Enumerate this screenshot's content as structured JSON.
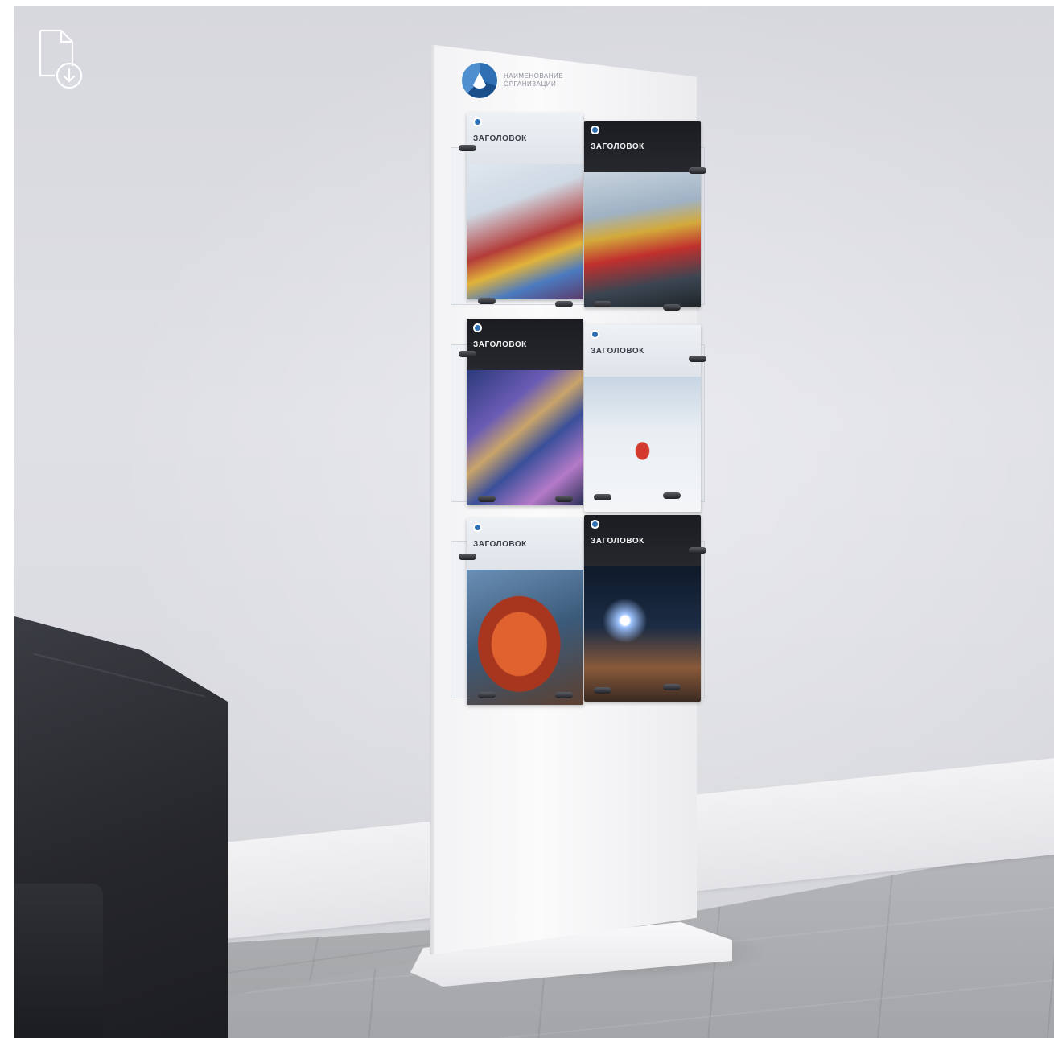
{
  "stand": {
    "logo_text": "НАИМЕНОВАНИЕ ОРГАНИЗАЦИИ"
  },
  "brochures": [
    {
      "title": "ЗАГОЛОВОК",
      "style": "light"
    },
    {
      "title": "ЗАГОЛОВОК",
      "style": "dark"
    },
    {
      "title": "ЗАГОЛОВОК",
      "style": "dark"
    },
    {
      "title": "ЗАГОЛОВОК",
      "style": "light"
    },
    {
      "title": "ЗАГОЛОВОК",
      "style": "light"
    },
    {
      "title": "ЗАГОЛОВОК",
      "style": "dark"
    }
  ],
  "icons": {
    "download": "document-download-icon",
    "logo": "rosatom-logo-icon"
  },
  "colors": {
    "brand_blue": "#2f6fb3",
    "wall": "#dcdde2",
    "sofa": "#26272c",
    "stand": "#f6f6f8"
  }
}
